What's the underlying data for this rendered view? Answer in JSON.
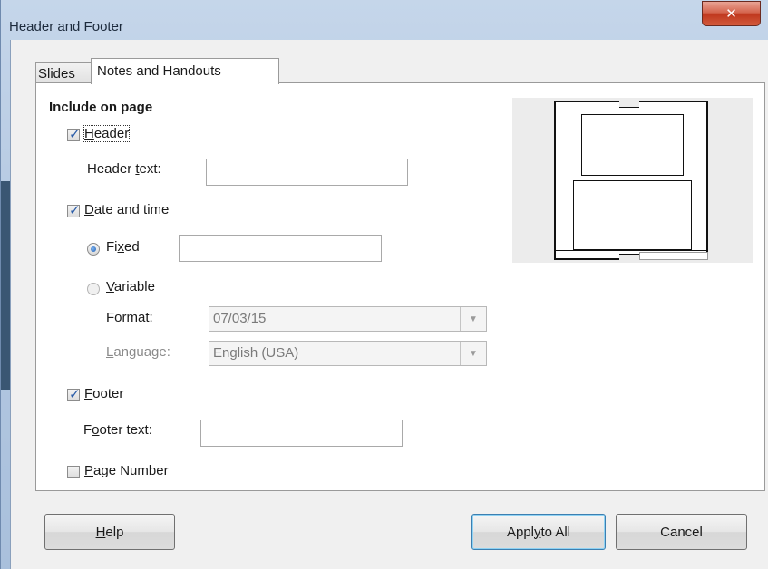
{
  "window": {
    "title": "Header and Footer",
    "close_glyph": "✕"
  },
  "tabs": [
    {
      "label": "Slides"
    },
    {
      "label": "Notes and Handouts"
    }
  ],
  "include": {
    "heading": "Include on page",
    "header": {
      "label_pre": "",
      "label_u": "H",
      "label_post": "eader",
      "checked": true
    },
    "header_text": {
      "pre": "Header ",
      "u": "t",
      "post": "ext:",
      "value": ""
    },
    "date_time": {
      "label_pre": "",
      "label_u": "D",
      "label_post": "ate and time",
      "checked": true
    },
    "fixed": {
      "pre": "Fi",
      "u": "x",
      "post": "ed",
      "selected": true,
      "value": ""
    },
    "variable": {
      "pre": "",
      "u": "V",
      "post": "ariable",
      "selected": false
    },
    "format": {
      "pre": "",
      "u": "F",
      "post": "ormat:",
      "value": "07/03/15"
    },
    "language": {
      "pre": "",
      "u": "L",
      "post": "anguage:",
      "value": "English (USA)"
    },
    "footer": {
      "label_pre": "",
      "label_u": "F",
      "label_post": "ooter",
      "checked": true
    },
    "footer_text": {
      "pre": "F",
      "u": "o",
      "post": "oter text:",
      "value": ""
    },
    "page_number": {
      "label_pre": "",
      "label_u": "P",
      "label_post": "age Number",
      "checked": false
    }
  },
  "buttons": {
    "help": {
      "pre": "",
      "u": "H",
      "post": "elp"
    },
    "apply_all": {
      "pre": "Appl",
      "u": "y",
      "post": " to All"
    },
    "cancel": {
      "label": "Cancel"
    }
  },
  "icons": {
    "dropdown": "chevron-down-icon",
    "close": "close-icon"
  },
  "colors": {
    "title_gradient": "#b5c9e2",
    "close_red": "#c0391f",
    "check_blue": "#2a5ca8"
  }
}
